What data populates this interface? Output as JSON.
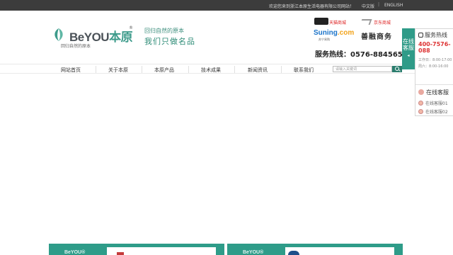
{
  "topbar": {
    "welcome": "欢迎您来到浙江本原生活电器有限公司网站！",
    "lang_zh": "中文版",
    "separator": "|",
    "lang_en": "ENGLISH"
  },
  "header": {
    "logo_en": "BeYOU",
    "logo_cn": "本原",
    "logo_reg": "®",
    "logo_sub": "回归自然的原本",
    "slogan_top": "回归自然的原本",
    "slogan_bottom_a": "我们只做",
    "slogan_bottom_b": "名品",
    "mall_tmall": "天猫商城",
    "mall_jd": "京东商城",
    "suning_a": "Suning",
    "suning_b": ".com",
    "suning_sub": "苏宁易购",
    "shanrong": "善融商务",
    "hotline_label": "服务热线：",
    "hotline_number": "0576-88456557"
  },
  "nav": {
    "items": [
      {
        "label": "网站首页"
      },
      {
        "label": "关于本原"
      },
      {
        "label": "本原产品"
      },
      {
        "label": "技术成果"
      },
      {
        "label": "新闻资讯"
      },
      {
        "label": "联系我们"
      }
    ],
    "search_placeholder": "请输入关键词"
  },
  "cards": [
    {
      "logo": "BeYOU®"
    },
    {
      "logo": "BeYOU®"
    }
  ],
  "float_service": {
    "tab_label": "在线客服",
    "hotline_title": "服务热线",
    "tel": "400-7576-088",
    "hours": "工作日：8:00-17:00 周六：8:00-16:00",
    "online_title": "在线客服",
    "agents": [
      {
        "label": "在线客服01"
      },
      {
        "label": "在线客服02"
      }
    ]
  },
  "colors": {
    "brand_green": "#2e9c89",
    "topbar_bg": "#3c3c3c",
    "hotline_red": "#d33333"
  }
}
